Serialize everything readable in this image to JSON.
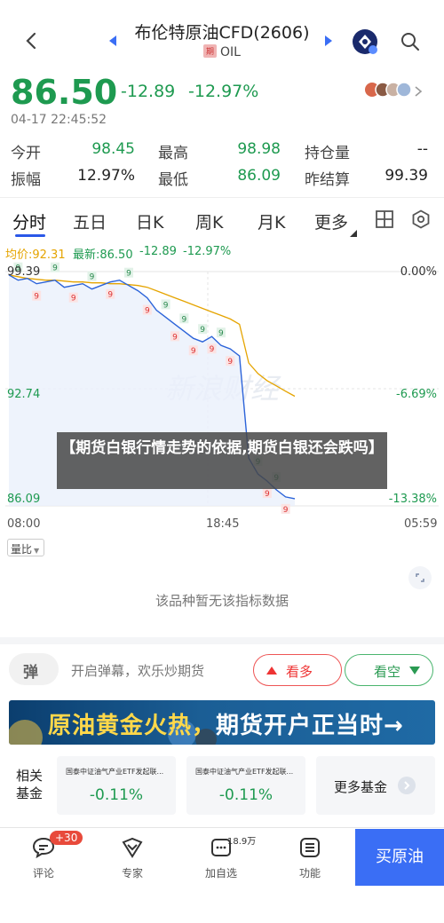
{
  "header": {
    "title": "布伦特原油CFD(2606)",
    "tag": "期",
    "subtitle": "OIL"
  },
  "quote": {
    "price": "86.50",
    "change": "-12.89",
    "change_pct": "-12.97%",
    "timestamp": "04-17 22:45:52"
  },
  "stats": [
    {
      "label": "今开",
      "value": "98.45"
    },
    {
      "label": "最高",
      "value": "98.98"
    },
    {
      "label": "持仓量",
      "value": "--"
    },
    {
      "label": "振幅",
      "value": "12.97%"
    },
    {
      "label": "最低",
      "value": "86.09"
    },
    {
      "label": "昨结算",
      "value": "99.39"
    }
  ],
  "tabs": [
    "分时",
    "五日",
    "日K",
    "周K",
    "月K",
    "更多"
  ],
  "chart_info": {
    "avg": "均价:92.31",
    "latest": "最新:86.50",
    "chg": "-12.89",
    "pct": "-12.97%"
  },
  "chart_data": {
    "type": "line",
    "title": "",
    "y_labels_left": [
      "99.39",
      "92.74",
      "86.09"
    ],
    "y_labels_right": [
      "0.00%",
      "-6.69%",
      "-13.38%"
    ],
    "x_labels": [
      "08:00",
      "18:45",
      "05:59"
    ],
    "ylim": [
      86.09,
      99.39
    ],
    "series": [
      {
        "values": [
          99.2,
          98.9,
          99.0,
          98.7,
          98.8,
          98.9,
          98.5,
          98.6,
          98.7,
          98.4,
          98.6,
          98.8,
          98.9,
          98.6,
          98.3,
          97.9,
          97.2,
          96.8,
          96.4,
          96.0,
          95.6,
          95.4,
          95.7,
          95.2,
          95.0,
          94.6,
          88.8,
          87.9,
          87.5,
          87.0,
          86.6,
          86.5
        ]
      },
      {
        "values": [
          99.2,
          99.1,
          99.0,
          98.95,
          98.9,
          98.9,
          98.85,
          98.8,
          98.8,
          98.75,
          98.75,
          98.7,
          98.7,
          98.65,
          98.6,
          98.5,
          98.3,
          98.1,
          97.9,
          97.7,
          97.5,
          97.3,
          97.1,
          96.9,
          96.7,
          96.4,
          94.2,
          93.6,
          93.2,
          92.9,
          92.6,
          92.31
        ]
      }
    ]
  },
  "overlay_title": "【期货白银行情走势的依据,期货白银还会跌吗】",
  "volume_select": "量比",
  "no_data": "该品种暂无该指标数据",
  "danmaku": {
    "icon_text": "弹",
    "placeholder": "开启弹幕，欢乐炒期货",
    "bull": "看多",
    "bear": "看空"
  },
  "banner": {
    "highlight": "原油黄金火热，",
    "rest": "期货开户正当时→"
  },
  "funds": {
    "label": "相关基金",
    "items": [
      {
        "name": "国泰中证油气产业ETF发起联...",
        "value": "-0.11%"
      },
      {
        "name": "国泰中证油气产业ETF发起联...",
        "value": "-0.11%"
      }
    ],
    "more": "更多基金"
  },
  "bottom_nav": [
    {
      "label": "评论",
      "badge": "+30"
    },
    {
      "label": "专家"
    },
    {
      "label": "加自选",
      "badge": "18.9万"
    },
    {
      "label": "功能"
    }
  ],
  "buy_button": "买原油",
  "colors": {
    "down": "#1e9a50",
    "up": "#e33333",
    "accent": "#3a6ef5"
  }
}
